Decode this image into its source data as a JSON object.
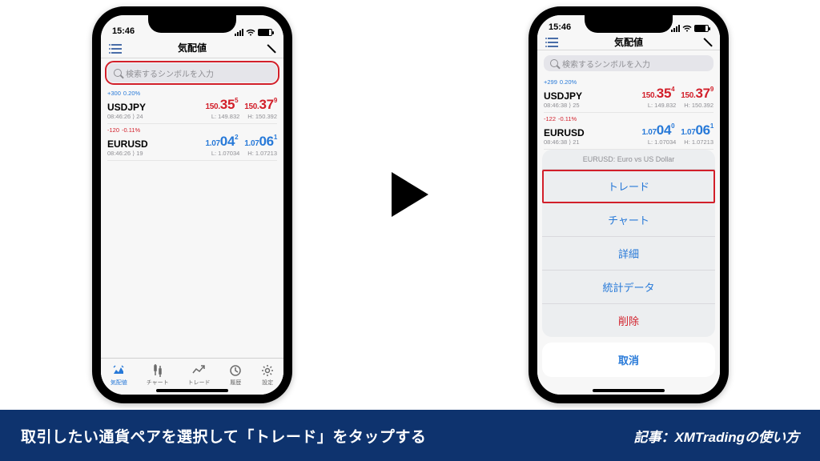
{
  "status": {
    "time": "15:46"
  },
  "navbar": {
    "title": "気配値"
  },
  "search": {
    "placeholder": "検索するシンボルを入力"
  },
  "left": {
    "rows": [
      {
        "delta": "+300",
        "pct": "0.20%",
        "dir": "up",
        "symbol": "USDJPY",
        "time": "08:46:26",
        "spread": "24",
        "bid_sm": "150.",
        "bid_big": "35",
        "bid_sup": "5",
        "ask_sm": "150.",
        "ask_big": "37",
        "ask_sup": "9",
        "low": "L: 149.832",
        "high": "H: 150.392",
        "bid_cls": "p-red",
        "ask_cls": "p-red"
      },
      {
        "delta": "-120",
        "pct": "-0.11%",
        "dir": "dn",
        "symbol": "EURUSD",
        "time": "08:46:26",
        "spread": "19",
        "bid_sm": "1.07",
        "bid_big": "04",
        "bid_sup": "2",
        "ask_sm": "1.07",
        "ask_big": "06",
        "ask_sup": "1",
        "low": "L: 1.07034",
        "high": "H: 1.07213",
        "bid_cls": "p-blue",
        "ask_cls": "p-blue"
      }
    ],
    "tabs": [
      "気配値",
      "チャート",
      "トレード",
      "履歴",
      "設定"
    ]
  },
  "right": {
    "rows": [
      {
        "delta": "+299",
        "pct": "0.20%",
        "dir": "up",
        "symbol": "USDJPY",
        "time": "08:46:38",
        "spread": "25",
        "bid_sm": "150.",
        "bid_big": "35",
        "bid_sup": "4",
        "ask_sm": "150.",
        "ask_big": "37",
        "ask_sup": "9",
        "low": "L: 149.832",
        "high": "H: 150.392",
        "bid_cls": "p-red",
        "ask_cls": "p-red"
      },
      {
        "delta": "-122",
        "pct": "-0.11%",
        "dir": "dn",
        "symbol": "EURUSD",
        "time": "08:46:38",
        "spread": "21",
        "bid_sm": "1.07",
        "bid_big": "04",
        "bid_sup": "0",
        "ask_sm": "1.07",
        "ask_big": "06",
        "ask_sup": "1",
        "low": "L: 1.07034",
        "high": "H: 1.07213",
        "bid_cls": "p-blue",
        "ask_cls": "p-blue"
      }
    ],
    "sheet": {
      "title": "EURUSD: Euro vs US Dollar",
      "items": [
        "トレード",
        "チャート",
        "詳細",
        "統計データ",
        "削除"
      ],
      "cancel": "取消"
    }
  },
  "caption": {
    "main": "取引したい通貨ペアを選択して「トレード」をタップする",
    "aside": "記事：XMTradingの使い方"
  }
}
